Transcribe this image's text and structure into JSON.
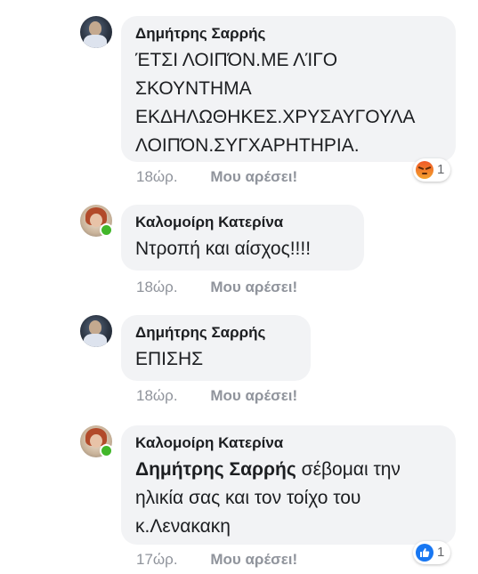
{
  "comments": [
    {
      "author": "Δημήτρης Σαρρής",
      "text": "ΈΤΣΙ ΛΟΙΠΌΝ.ΜΕ ΛΊΓΟ\nΣΚΟΥΝΤΗΜΑ\nΕΚΔΗΛΩΘΗΚΕΣ.ΧΡΥΣΑΥΓΟΥΛΑ\nΛΟΙΠΌΝ.ΣΥΓΧΑΡΗΤΗΡΙΑ.",
      "time": "18ώρ.",
      "like_label": "Μου αρέσει!",
      "reaction": {
        "icon": "angry-reaction-icon",
        "count": "1"
      }
    },
    {
      "author": "Καλομοίρη Κατερίνα",
      "text": "Ντροπή και αίσχος!!!!",
      "time": "18ώρ.",
      "like_label": "Μου αρέσει!"
    },
    {
      "author": "Δημήτρης Σαρρής",
      "text": "ΕΠΙΣΗΣ",
      "time": "18ώρ.",
      "like_label": "Μου αρέσει!"
    },
    {
      "author": "Καλομοίρη Κατερίνα",
      "mention": "Δημήτρης Σαρρής",
      "text": " σέβομαι την\nηλικία σας και τον τοίχο του\nκ.Λενακακη",
      "time": "17ώρ.",
      "like_label": "Μου αρέσει!",
      "reaction": {
        "icon": "like-reaction-icon",
        "count": "1"
      }
    }
  ],
  "colors": {
    "bubble": "#f2f3f5",
    "meta_text": "#90949c",
    "online": "#42b72a",
    "like_blue": "#1877f2",
    "angry_orange": "#f05a28"
  }
}
